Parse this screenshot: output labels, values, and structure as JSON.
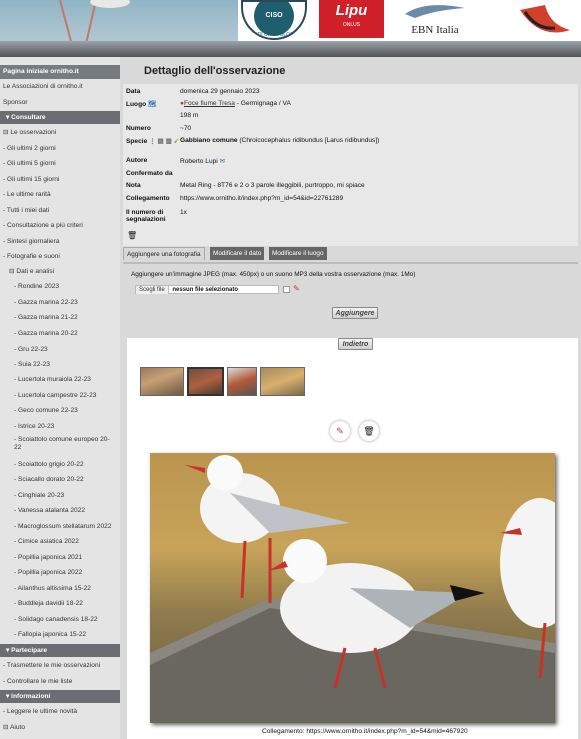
{
  "header": {
    "logo_ciso_text": "STUDI ORNITOLOGICI",
    "logo_ciso_abbr": "CISO",
    "logo_lipu": "Lipu",
    "logo_lipu_sub": "ONLUS",
    "logo_ebn": "EBN Italia"
  },
  "sidebar": {
    "home": "Pagina iniziale ornitho.it",
    "items_top": [
      "Le Associazioni di ornitho.it",
      "Sponsor"
    ],
    "section_consult": "Consultare",
    "observations": "Le osservazioni",
    "obs_items": [
      "- Gli ultimi 2 giorni",
      "- Gli ultimi 5 giorni",
      "- Gli ultimi 15 giorni",
      "- Le ultime rarità",
      "- Tutti i miei dati",
      "- Consultazione a più criteri",
      "- Sintesi giornaliera",
      "- Fotografie e suoni"
    ],
    "analysis": "Dati e analisi",
    "analysis_items": [
      "- Rondine 2023",
      "- Gazza marina 22-23",
      "- Gazza marina 21-22",
      "- Gazza marina 20-22",
      "- Gru 22-23",
      "- Suia 22-23",
      "- Lucertola muraiola 22-23",
      "- Lucertola campestre 22-23",
      "- Geco comune 22-23",
      "- Istrice 20-23",
      "- Scoiattolo comune europeo 20-22",
      "- Scoiattolo grigio 20-22",
      "- Sciacallo dorato 20-22",
      "- Cinghiale 20-23",
      "- Vanessa atalanta 2022",
      "- Macroglossum stellatarum 2022",
      "- Cimice asiatica 2022",
      "- Popillia japonica 2021",
      "- Popillia japonica 2022",
      "- Ailanthus altissima 15-22",
      "- Buddleja davidii 18-22",
      "- Solidago canadensis 18-22",
      "- Fallopia japonica 15-22"
    ],
    "section_participate": "Partecipare",
    "participate_items": [
      "- Trasmettere le mie osservazioni",
      "- Controllare le mie liste"
    ],
    "section_info": "Informazioni",
    "info_items": [
      "- Leggere le ultime novità"
    ],
    "help": "Aiuto"
  },
  "main": {
    "title": "Dettaglio dell'osservazione",
    "date_label": "Data",
    "date_value": "domenica 29 gennaio 2023",
    "place_label": "Luogo",
    "place_link": "Foce fiume Tresa",
    "place_rest": " - Germignaga / VA",
    "altitude": "198 m",
    "count_label": "Numero",
    "count_value": "~70",
    "species_label": "Specie",
    "species_name": "Gabbiano comune",
    "species_latin": " (Chroicocephalus ridibundus [Larus ridibundus])",
    "author_label": "Autore",
    "author_value": "Roberto Lupi",
    "confirmed_label": "Confermato da",
    "note_label": "Nota",
    "note_value": "Metal Ring - 8T76 e 2 o 3 parole illeggibili, purtroppo, mi spiace",
    "link_label": "Collegamento",
    "link_value": "https://www.ornitho.it/index.php?m_id=54&id=22761289",
    "reports_label": "Il numero di segnalazioni",
    "reports_value": "1x",
    "tabs": [
      "Aggiungere una fotografia",
      "Modificare il dato",
      "Modificare il luogo"
    ],
    "upload_text": "Aggiungere un'immagine JPEG (max. 450px) o un suono MP3 della vostra osservazione (max. 1Mo)",
    "choose_file": "Scegli file",
    "no_file": "nessun file selezionato",
    "add_button": "Aggiungere",
    "back_button": "Indietro",
    "caption_label": "Collegamento:",
    "caption_link": "https://www.ornitho.it/index.php?m_id=54&mid=467920"
  }
}
